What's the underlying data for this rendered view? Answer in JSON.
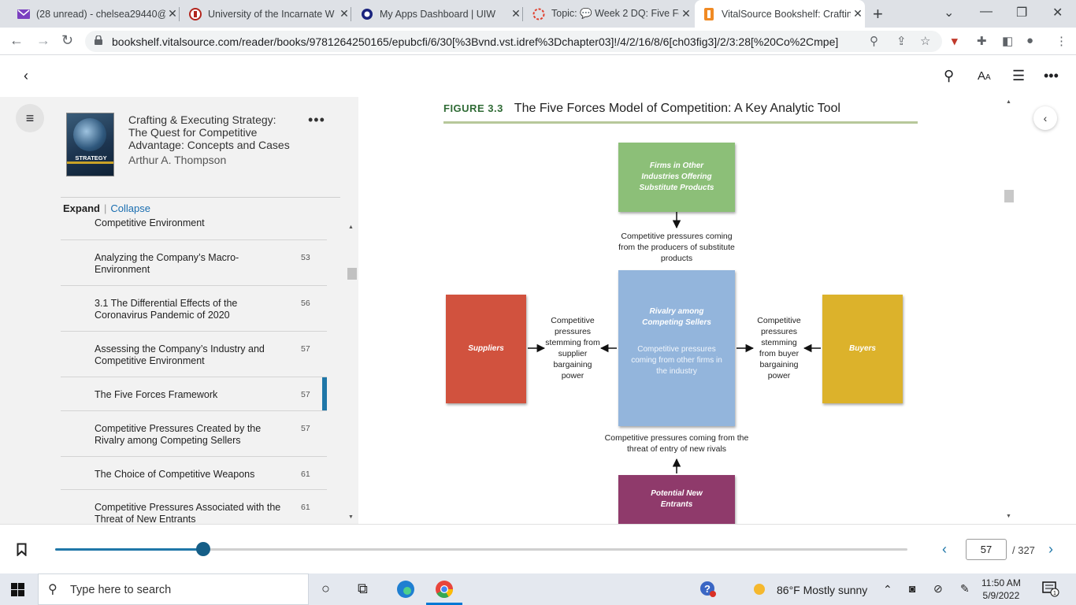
{
  "browser": {
    "tabs": [
      {
        "title": "(28 unread) - chelsea29440@",
        "icon": "mail-icon",
        "color": "#6b2fa8"
      },
      {
        "title": "University of the Incarnate W",
        "icon": "uiw-icon",
        "color": "#b3261e"
      },
      {
        "title": "My Apps Dashboard | UIW",
        "icon": "okta-icon",
        "color": "#1a237e"
      },
      {
        "title": "Topic: 💬 Week 2 DQ: Five Fo",
        "icon": "canvas-icon",
        "color": "#e03e2d"
      },
      {
        "title": "VitalSource Bookshelf: Craftin",
        "icon": "vitalsource-icon",
        "color": "#f08a24"
      }
    ],
    "address": "bookshelf.vitalsource.com/reader/books/9781264250165/epubcfi/6/30[%3Bvnd.vst.idref%3Dchapter03]!/4/2/16/8/6[ch03fig3]/2/3:28[%20Co%2Cmpe]"
  },
  "book": {
    "title": "Crafting & Executing Strategy: The Quest for Competitive Advantage: Concepts and Cases",
    "author": "Arthur A. Thompson",
    "cover_title": "STRATEGY"
  },
  "toc": {
    "expand": "Expand",
    "collapse": "Collapse",
    "items": [
      {
        "label": "Competitive Environment",
        "page": ""
      },
      {
        "label": "Analyzing the Company’s Macro-Environment",
        "page": "53"
      },
      {
        "label": "3.1 The Differential Effects of the Coronavirus Pandemic of 2020",
        "page": "56"
      },
      {
        "label": "Assessing the Company’s Industry and Competitive Environment",
        "page": "57"
      },
      {
        "label": "The Five Forces Framework",
        "page": "57",
        "active": true
      },
      {
        "label": "Competitive Pressures Created by the Rivalry among Competing Sellers",
        "page": "57"
      },
      {
        "label": "The Choice of Competitive Weapons",
        "page": "61"
      },
      {
        "label": "Competitive Pressures Associated with the Threat of New Entrants",
        "page": "61"
      }
    ]
  },
  "figure": {
    "number": "FIGURE 3.3",
    "title": "The Five Forces Model of Competition: A Key Analytic Tool",
    "substitutes": "Firms in Other Industries Offering Substitute Products",
    "substitutes_pressure": "Competitive pressures coming from the producers of substitute products",
    "rivalry": "Rivalry among Competing Sellers",
    "rivalry_sub": "Competitive pressures coming from other firms in the industry",
    "suppliers": "Suppliers",
    "supplier_pressure": "Competitive pressures stemming from supplier bargaining power",
    "buyers": "Buyers",
    "buyer_pressure": "Competitive pressures stemming from buyer bargaining power",
    "entrants_pressure": "Competitive pressures coming from the threat of entry of new rivals",
    "entrants": "Potential New Entrants"
  },
  "reader": {
    "current_page": "57",
    "total_pages": "/ 327",
    "progress": 0.174
  },
  "taskbar": {
    "search_placeholder": "Type here to search",
    "weather": "86°F  Mostly sunny",
    "time": "11:50 AM",
    "date": "5/9/2022"
  }
}
